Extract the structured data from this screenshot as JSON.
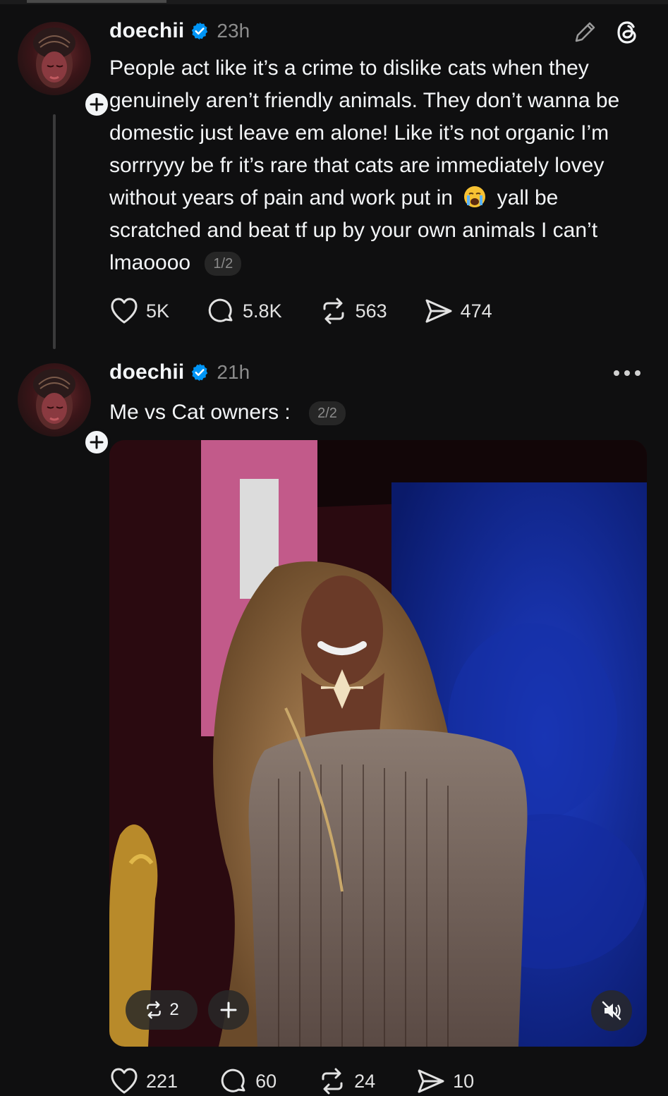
{
  "posts": [
    {
      "username": "doechii",
      "time": "23h",
      "text_before_emoji": "People act like it’s a crime to dislike cats when they genuinely aren’t friendly animals. They don’t wanna be domestic just leave em alone! Like it’s not organic I’m sorrryyy be fr it’s rare that cats are immediately lovey without years of pain and work put in",
      "emoji": "loudly-crying-face",
      "text_after_emoji": "yall be scratched and beat tf up by your own animals I can’t lmaoooo",
      "page_indicator": "1/2",
      "likes": "5K",
      "replies": "5.8K",
      "reposts": "563",
      "shares": "474"
    },
    {
      "username": "doechii",
      "time": "21h",
      "text": "Me vs Cat owners :",
      "page_indicator": "2/2",
      "media": {
        "repost_count": "2"
      },
      "likes": "221",
      "replies": "60",
      "reposts": "24",
      "shares": "10"
    }
  ],
  "icons": {
    "edit": "pencil-icon",
    "app": "threads-logo-icon",
    "more": "more-horizontal-icon",
    "like": "heart-icon",
    "reply": "comment-icon",
    "repost": "repost-icon",
    "share": "send-icon",
    "mute": "muted-speaker-icon",
    "add": "plus-icon"
  },
  "colors": {
    "background": "#0f0f10",
    "text": "#f3f5f7",
    "muted": "#8c8c8c",
    "verified": "#0095f6"
  }
}
